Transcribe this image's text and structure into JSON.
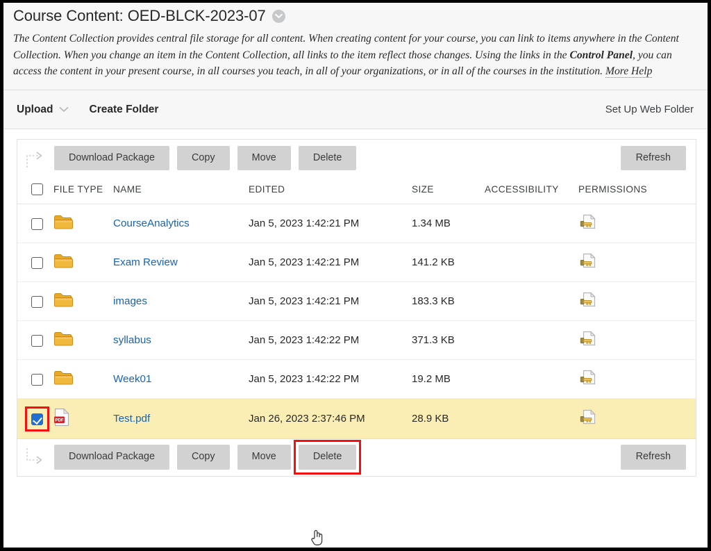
{
  "header": {
    "title": "Course Content: OED-BLCK-2023-07",
    "chevron_icon": "chevron-down-icon",
    "description_part1": "The Content Collection provides central file storage for all content. When creating content for your course, you can link to items anywhere in the Content Collection. When you change an item in the Content Collection, all links to the item reflect those changes. Using the links in the ",
    "description_bold": "Control Panel",
    "description_part2": ", you can access the content in your present course, in all courses you teach, in all of your organizations, or in all of the courses in the institution. ",
    "more_help_label": "More Help"
  },
  "action_bar": {
    "upload_label": "Upload",
    "upload_caret_icon": "chevron-down-icon",
    "create_folder_label": "Create Folder",
    "set_up_web_folder_label": "Set Up Web Folder"
  },
  "toolbar": {
    "elbow_icon": "arrow-elbow-right-icon",
    "download_package_label": "Download Package",
    "copy_label": "Copy",
    "move_label": "Move",
    "delete_label": "Delete",
    "refresh_label": "Refresh"
  },
  "table": {
    "select_all_checkbox": false,
    "columns": [
      "FILE TYPE",
      "NAME",
      "EDITED",
      "SIZE",
      "ACCESSIBILITY",
      "PERMISSIONS"
    ],
    "rows": [
      {
        "checked": false,
        "type_icon": "folder-icon",
        "name": "CourseAnalytics",
        "edited": "Jan 5, 2023 1:42:21 PM",
        "size": "1.34 MB",
        "accessibility": "",
        "permissions_icon": "page-key-icon",
        "selected": false
      },
      {
        "checked": false,
        "type_icon": "folder-icon",
        "name": "Exam Review",
        "edited": "Jan 5, 2023 1:42:21 PM",
        "size": "141.2 KB",
        "accessibility": "",
        "permissions_icon": "page-key-icon",
        "selected": false
      },
      {
        "checked": false,
        "type_icon": "folder-icon",
        "name": "images",
        "edited": "Jan 5, 2023 1:42:21 PM",
        "size": "183.3 KB",
        "accessibility": "",
        "permissions_icon": "page-key-icon",
        "selected": false
      },
      {
        "checked": false,
        "type_icon": "folder-icon",
        "name": "syllabus",
        "edited": "Jan 5, 2023 1:42:22 PM",
        "size": "371.3 KB",
        "accessibility": "",
        "permissions_icon": "page-key-icon",
        "selected": false
      },
      {
        "checked": false,
        "type_icon": "folder-icon",
        "name": "Week01",
        "edited": "Jan 5, 2023 1:42:22 PM",
        "size": "19.2 MB",
        "accessibility": "",
        "permissions_icon": "page-key-icon",
        "selected": false
      },
      {
        "checked": true,
        "type_icon": "pdf-file-icon",
        "name": "Test.pdf",
        "edited": "Jan 26, 2023 2:37:46 PM",
        "size": "28.9 KB",
        "accessibility": "",
        "permissions_icon": "page-key-icon",
        "selected": true
      }
    ]
  },
  "annotations": {
    "highlight_color": "#f41010",
    "row_highlight_color": "#fbeeb4",
    "link_color": "#1862b5",
    "button_color": "#d2d2d2",
    "cursor_icon": "hand-pointer-cursor"
  }
}
